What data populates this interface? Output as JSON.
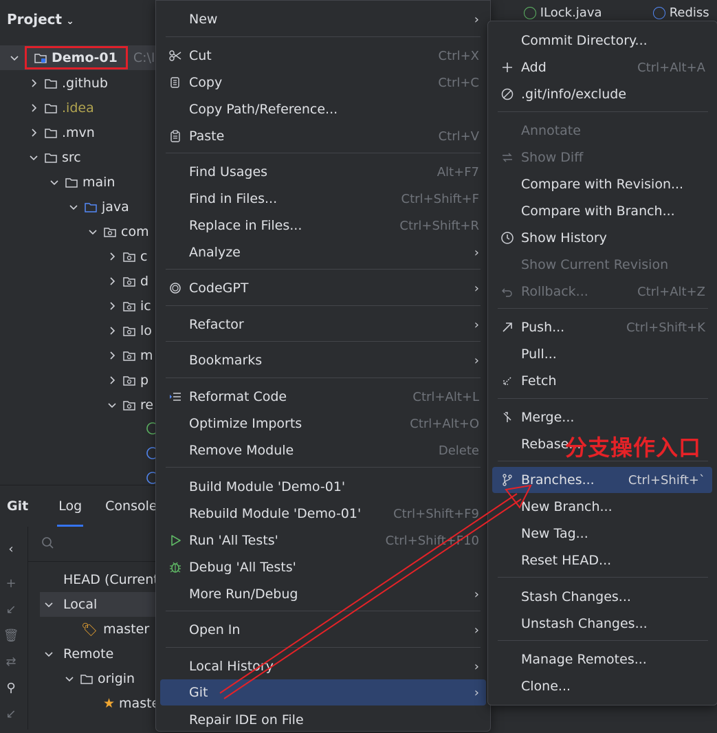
{
  "project": {
    "title": "Project",
    "tree": [
      {
        "label": "Demo-01",
        "path": "C:\\IDE"
      },
      {
        "label": ".github"
      },
      {
        "label": ".idea"
      },
      {
        "label": ".mvn"
      },
      {
        "label": "src"
      },
      {
        "label": "main"
      },
      {
        "label": "java"
      },
      {
        "label": "com"
      },
      {
        "label": "c"
      },
      {
        "label": "d"
      },
      {
        "label": "ic"
      },
      {
        "label": "lo"
      },
      {
        "label": "m"
      },
      {
        "label": "p"
      },
      {
        "label": "re"
      }
    ]
  },
  "git_panel": {
    "tabs": [
      "Git",
      "Log",
      "Console"
    ],
    "rows": [
      {
        "label": "HEAD (Current"
      },
      {
        "label": "Local"
      },
      {
        "label": "master"
      },
      {
        "label": "Remote"
      },
      {
        "label": "origin"
      },
      {
        "label": "maste"
      }
    ]
  },
  "editor_tabs": [
    "ILock.java",
    "Rediss"
  ],
  "context_menu": {
    "items": [
      {
        "label": "New",
        "shortcut": "",
        "submenu": true
      },
      {
        "label": "Cut",
        "shortcut": "Ctrl+X",
        "icon": "scissors-icon"
      },
      {
        "label": "Copy",
        "shortcut": "Ctrl+C",
        "icon": "copy-icon"
      },
      {
        "label": "Copy Path/Reference...",
        "shortcut": ""
      },
      {
        "label": "Paste",
        "shortcut": "Ctrl+V",
        "icon": "paste-icon"
      },
      {
        "label": "Find Usages",
        "shortcut": "Alt+F7"
      },
      {
        "label": "Find in Files...",
        "shortcut": "Ctrl+Shift+F"
      },
      {
        "label": "Replace in Files...",
        "shortcut": "Ctrl+Shift+R"
      },
      {
        "label": "Analyze",
        "shortcut": "",
        "submenu": true
      },
      {
        "label": "CodeGPT",
        "shortcut": "",
        "submenu": true,
        "icon": "codegpt-icon"
      },
      {
        "label": "Refactor",
        "shortcut": "",
        "submenu": true
      },
      {
        "label": "Bookmarks",
        "shortcut": "",
        "submenu": true
      },
      {
        "label": "Reformat Code",
        "shortcut": "Ctrl+Alt+L",
        "icon": "reformat-icon"
      },
      {
        "label": "Optimize Imports",
        "shortcut": "Ctrl+Alt+O"
      },
      {
        "label": "Remove Module",
        "shortcut": "Delete"
      },
      {
        "label": "Build Module 'Demo-01'",
        "shortcut": ""
      },
      {
        "label": "Rebuild Module 'Demo-01'",
        "shortcut": "Ctrl+Shift+F9"
      },
      {
        "label": "Run 'All Tests'",
        "shortcut": "Ctrl+Shift+F10",
        "icon": "run-icon"
      },
      {
        "label": "Debug 'All Tests'",
        "shortcut": "",
        "icon": "debug-icon"
      },
      {
        "label": "More Run/Debug",
        "shortcut": "",
        "submenu": true
      },
      {
        "label": "Open In",
        "shortcut": "",
        "submenu": true
      },
      {
        "label": "Local History",
        "shortcut": "",
        "submenu": true
      },
      {
        "label": "Git",
        "shortcut": "",
        "submenu": true
      },
      {
        "label": "Repair IDE on File",
        "shortcut": ""
      }
    ]
  },
  "git_menu": {
    "items": [
      {
        "label": "Commit Directory...",
        "shortcut": ""
      },
      {
        "label": "Add",
        "shortcut": "Ctrl+Alt+A",
        "icon": "plus-icon"
      },
      {
        "label": ".git/info/exclude",
        "shortcut": "",
        "icon": "ignore-icon"
      },
      {
        "label": "Annotate",
        "shortcut": "",
        "disabled": true
      },
      {
        "label": "Show Diff",
        "shortcut": "",
        "disabled": true,
        "icon": "diff-icon"
      },
      {
        "label": "Compare with Revision...",
        "shortcut": ""
      },
      {
        "label": "Compare with Branch...",
        "shortcut": ""
      },
      {
        "label": "Show History",
        "shortcut": "",
        "icon": "clock-icon"
      },
      {
        "label": "Show Current Revision",
        "shortcut": "",
        "disabled": true
      },
      {
        "label": "Rollback...",
        "shortcut": "Ctrl+Alt+Z",
        "disabled": true,
        "icon": "rollback-icon"
      },
      {
        "label": "Push...",
        "shortcut": "Ctrl+Shift+K",
        "icon": "push-icon"
      },
      {
        "label": "Pull...",
        "shortcut": ""
      },
      {
        "label": "Fetch",
        "shortcut": "",
        "icon": "fetch-icon"
      },
      {
        "label": "Merge...",
        "shortcut": "",
        "icon": "merge-icon"
      },
      {
        "label": "Rebase...",
        "shortcut": ""
      },
      {
        "label": "Branches...",
        "shortcut": "Ctrl+Shift+`",
        "icon": "branch-icon"
      },
      {
        "label": "New Branch...",
        "shortcut": ""
      },
      {
        "label": "New Tag...",
        "shortcut": ""
      },
      {
        "label": "Reset HEAD...",
        "shortcut": ""
      },
      {
        "label": "Stash Changes...",
        "shortcut": ""
      },
      {
        "label": "Unstash Changes...",
        "shortcut": ""
      },
      {
        "label": "Manage Remotes...",
        "shortcut": ""
      },
      {
        "label": "Clone...",
        "shortcut": ""
      }
    ]
  },
  "annotation": {
    "text": "分支操作入口",
    "color": "#e62227"
  },
  "colors": {
    "background": "#2b2d30",
    "active_item": "#2e436e",
    "accent_red": "#e0202a",
    "disabled_text": "#6f737a"
  }
}
